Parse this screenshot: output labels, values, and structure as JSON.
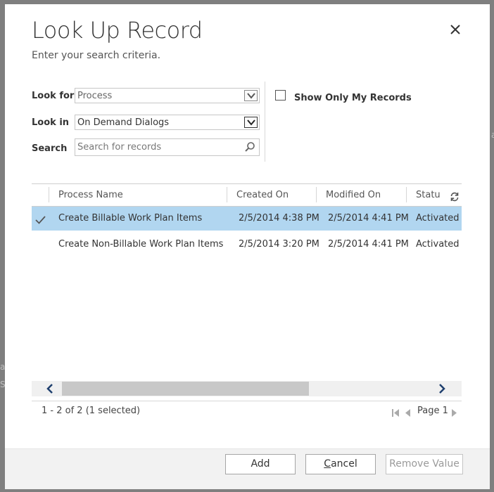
{
  "dialog": {
    "title": "Look Up Record",
    "subtitle": "Enter your search criteria.",
    "close_icon": "close-icon"
  },
  "form": {
    "look_for_label": "Look for",
    "look_for_value": "Process",
    "look_in_label": "Look in",
    "look_in_value": "On Demand Dialogs",
    "search_label": "Search",
    "search_placeholder": "Search for records",
    "show_only_my_records": "Show Only My Records",
    "show_only_my_records_checked": false
  },
  "grid": {
    "columns": [
      "Process Name",
      "Created On",
      "Modified On",
      "Statu"
    ],
    "rows": [
      {
        "name": "Create Billable Work Plan Items",
        "created": "2/5/2014 4:38 PM",
        "modified": "2/5/2014 4:41 PM",
        "status": "Activated",
        "selected": true
      },
      {
        "name": "Create Non-Billable Work Plan Items",
        "created": "2/5/2014 3:20 PM",
        "modified": "2/5/2014 4:41 PM",
        "status": "Activated",
        "selected": false
      }
    ],
    "record_count": "1 - 2 of 2 (1 selected)",
    "page_label": "Page 1"
  },
  "buttons": {
    "add": "Add",
    "cancel": "Cancel",
    "remove_value": "Remove Value"
  },
  "colors": {
    "selected_row": "#b1d6f0",
    "footer_bg": "#f2f2f2",
    "overlay": "#7f7f7f"
  }
}
